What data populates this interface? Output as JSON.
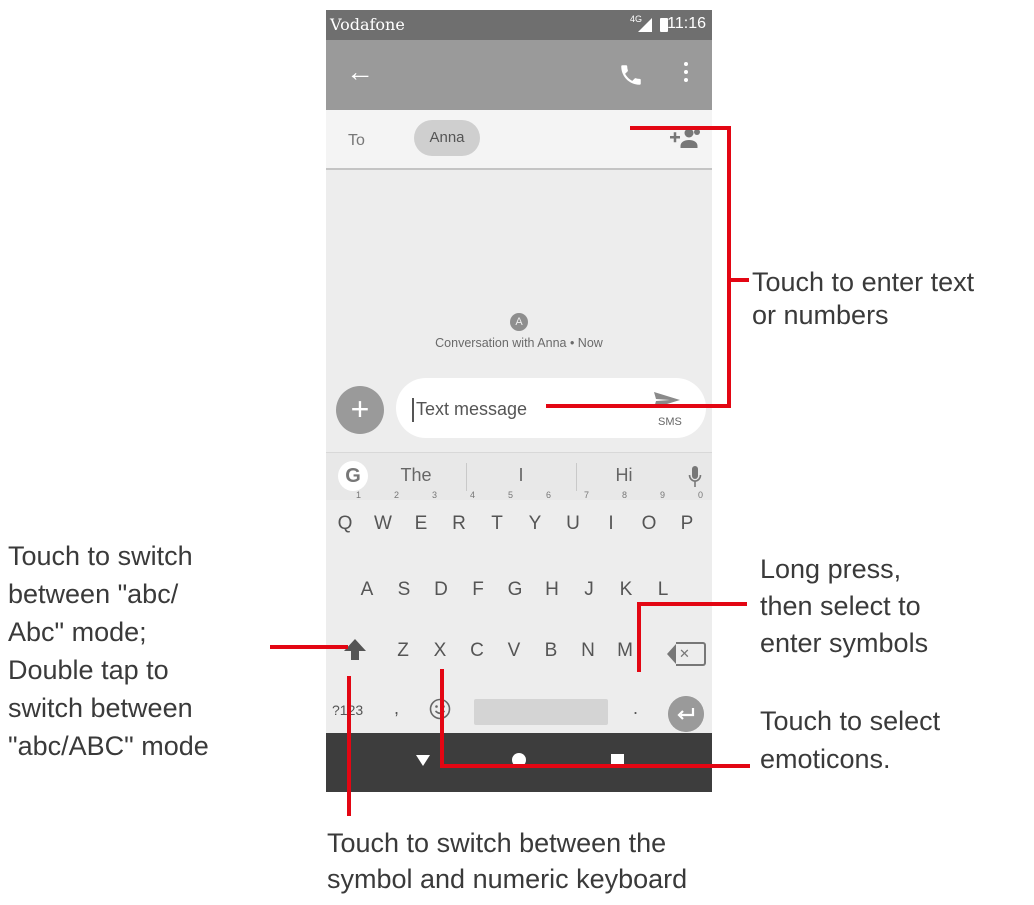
{
  "status_bar": {
    "carrier": "Vodafone",
    "network": "4G",
    "time": "11:16"
  },
  "app_bar": {
    "back_icon": "arrow-left-icon",
    "call_icon": "phone-icon",
    "menu_icon": "more-vert-icon"
  },
  "recipients": {
    "to_label": "To",
    "chip": "Anna",
    "add_icon": "add-person-icon"
  },
  "conversation": {
    "avatar_letter": "A",
    "info": "Conversation with Anna • Now"
  },
  "compose": {
    "placeholder": "Text message",
    "send_mode": "SMS"
  },
  "suggestions": {
    "items": [
      "The",
      "I",
      "Hi"
    ]
  },
  "keyboard": {
    "row1": [
      {
        "key": "Q",
        "hint": "1"
      },
      {
        "key": "W",
        "hint": "2"
      },
      {
        "key": "E",
        "hint": "3"
      },
      {
        "key": "R",
        "hint": "4"
      },
      {
        "key": "T",
        "hint": "5"
      },
      {
        "key": "Y",
        "hint": "6"
      },
      {
        "key": "U",
        "hint": "7"
      },
      {
        "key": "I",
        "hint": "8"
      },
      {
        "key": "O",
        "hint": "9"
      },
      {
        "key": "P",
        "hint": "0"
      }
    ],
    "row2": [
      "A",
      "S",
      "D",
      "F",
      "G",
      "H",
      "J",
      "K",
      "L"
    ],
    "row3": [
      "Z",
      "X",
      "C",
      "V",
      "B",
      "N",
      "M"
    ],
    "symbols_key": "?123",
    "comma": ",",
    "period": "."
  },
  "annotations": {
    "enter_text": "Touch to enter text\nor numbers",
    "shift_mode": "Touch to switch\nbetween \"abc/\nAbc\" mode;\nDouble tap to\nswitch between\n\"abc/ABC\" mode",
    "long_press": "Long press,\nthen select to\nenter symbols",
    "emoticons": "Touch to select\nemoticons.",
    "symbol_keyboard": "Touch to switch between the\nsymbol and numeric keyboard"
  },
  "colors": {
    "annotation_line": "#e30613",
    "status_bar": "#6f6f6f",
    "app_bar": "#9a9a9a",
    "nav_bar": "#3d3d3d"
  }
}
